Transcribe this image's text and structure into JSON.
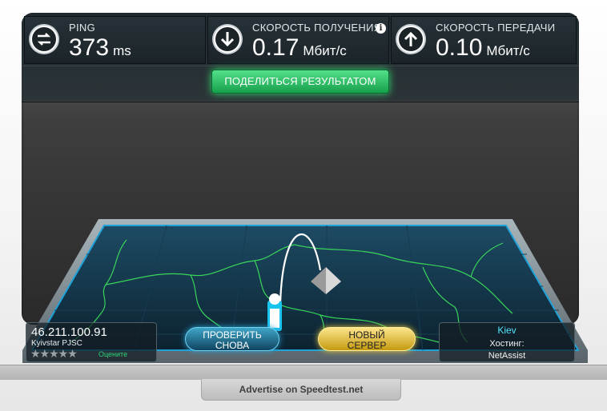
{
  "stats": {
    "ping": {
      "label": "PING",
      "value": "373",
      "unit": "ms"
    },
    "download": {
      "label": "СКОРОСТЬ ПОЛУЧЕНИЯ",
      "value": "0.17",
      "unit": "Мбит/с"
    },
    "upload": {
      "label": "СКОРОСТЬ ПЕРЕДАЧИ",
      "value": "0.10",
      "unit": "Мбит/с"
    }
  },
  "share_label": "ПОДЕЛИТЬСЯ РЕЗУЛЬТАТОМ",
  "client": {
    "ip": "46.211.100.91",
    "isp": "Kyivstar PJSC",
    "stars": "★★★★★",
    "rate_label": "Оцените"
  },
  "buttons": {
    "retest": "ПРОВЕРИТЬ СНОВА",
    "new_server": "НОВЫЙ СЕРВЕР"
  },
  "server": {
    "city": "Kiev",
    "hosting_label": "Хостинг:",
    "host": "NetAssist"
  },
  "advert": "Advertise on Speedtest.net",
  "colors": {
    "accent_green": "#36d66f",
    "accent_blue": "#2a9fd0",
    "accent_gold": "#e8c83a",
    "map_line": "#39d65a"
  },
  "icons": {
    "ping": "swap-arrows-icon",
    "download": "arrow-down-icon",
    "upload": "arrow-up-icon",
    "info": "info-icon"
  }
}
